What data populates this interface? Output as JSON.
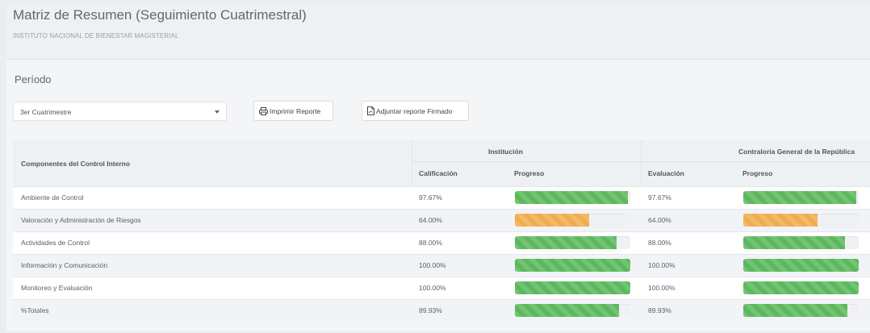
{
  "header": {
    "title": "Matriz de Resumen (Seguimiento Cuatrimestral)",
    "subtitle": "INSTITUTO NACIONAL DE BIENESTAR MAGISTERIAL"
  },
  "period": {
    "label": "Período",
    "selected": "3er Cuatrimestre"
  },
  "buttons": {
    "print": "Imprimir Reporte",
    "attach": "Adjuntar reporte Firmado"
  },
  "table": {
    "col_components": "Componentes del Control Interno",
    "group_institution": "Institución",
    "group_contraloria": "Contraloría General de la República",
    "col_calificacion": "Calificación",
    "col_progreso_1": "Progreso",
    "col_evaluacion": "Evaluación",
    "col_progreso_2": "Progreso",
    "rows": [
      {
        "name": "Ambiente de Control",
        "calificacion": "97.67%",
        "evaluacion": "97.67%",
        "progress": 0.9767,
        "status": "success"
      },
      {
        "name": "Valoración y Administración de Riesgos",
        "calificacion": "64.00%",
        "evaluacion": "64.00%",
        "progress": 0.64,
        "status": "warning"
      },
      {
        "name": "Actividades de Control",
        "calificacion": "88.00%",
        "evaluacion": "88.00%",
        "progress": 0.88,
        "status": "success"
      },
      {
        "name": "Información y Comunicación",
        "calificacion": "100.00%",
        "evaluacion": "100.00%",
        "progress": 1.0,
        "status": "success"
      },
      {
        "name": "Monitoreo y Evaluación",
        "calificacion": "100.00%",
        "evaluacion": "100.00%",
        "progress": 1.0,
        "status": "success"
      },
      {
        "name": "%Totales",
        "calificacion": "89.93%",
        "evaluacion": "89.93%",
        "progress": 0.8993,
        "status": "success"
      }
    ]
  },
  "colors": {
    "success": "#5cb85c",
    "warning": "#f0ad4e"
  },
  "icons": {
    "print": "printer-icon",
    "attach": "pdf-file-icon",
    "select": "caret-down-icon"
  }
}
